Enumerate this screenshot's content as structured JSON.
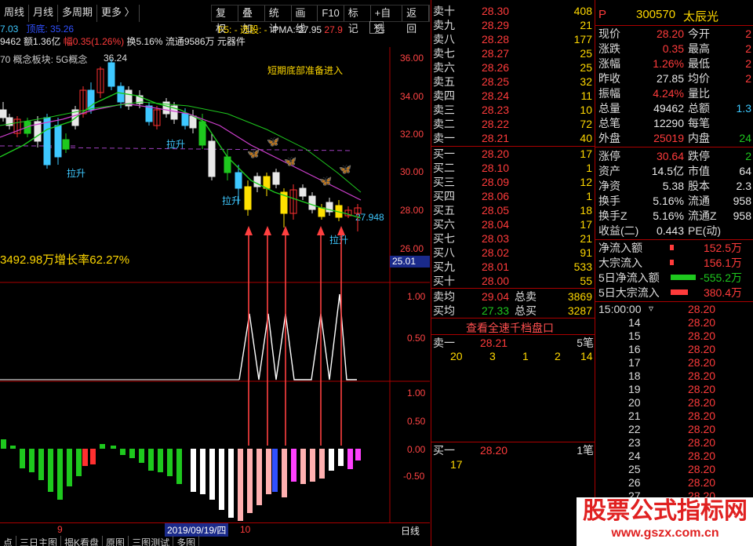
{
  "toolbar": {
    "left": [
      "周线",
      "月线",
      "多周期",
      "更多 〉"
    ],
    "right": [
      "复权",
      "叠加",
      "统计",
      "画线",
      "F10",
      "标记",
      "+自选",
      "返回"
    ]
  },
  "info_row": {
    "a": "7.03",
    "b": "顶底: 35.26",
    "vol": "9462 额1.36亿",
    "amp": "幅0.35(1.26%)",
    "turn": "换5.16% 流通9586万 元器件",
    "f5": "F5:",
    "sel": "- 选股: -",
    "pma": "PMA: 27.95",
    "pma2": "27.9"
  },
  "concept": "70 概念板块: 5G概念",
  "hi_label": "36.24",
  "annot": "短期底部准备进入",
  "lift_labels": [
    "拉升",
    "拉升",
    "拉升",
    "拉升"
  ],
  "last_val": "27.948",
  "growth": "3492.98万增长率62.27%",
  "price_axis": [
    "36.00",
    "34.00",
    "32.00",
    "30.00",
    "28.00",
    "26.00"
  ],
  "cur_price_tag": "25.01",
  "ind1_axis": [
    "1.00",
    "0.50"
  ],
  "ind2_axis": [
    "1.00",
    "0.50",
    "0.00",
    "-0.50"
  ],
  "date_bar": {
    "d1": "9",
    "d2": "2019/09/19/四",
    "d3": "10",
    "period": "日线"
  },
  "bottom_tabs": [
    "点",
    "三日主图",
    "揭K看盘",
    "原图",
    "三图测试",
    "多图"
  ],
  "orderbook": {
    "asks": [
      {
        "label": "卖十",
        "price": "28.30",
        "vol": "408"
      },
      {
        "label": "卖九",
        "price": "28.29",
        "vol": "21"
      },
      {
        "label": "卖八",
        "price": "28.28",
        "vol": "177"
      },
      {
        "label": "卖七",
        "price": "28.27",
        "vol": "25"
      },
      {
        "label": "卖六",
        "price": "28.26",
        "vol": "25"
      },
      {
        "label": "卖五",
        "price": "28.25",
        "vol": "32"
      },
      {
        "label": "卖四",
        "price": "28.24",
        "vol": "11"
      },
      {
        "label": "卖三",
        "price": "28.23",
        "vol": "10"
      },
      {
        "label": "卖二",
        "price": "28.22",
        "vol": "72"
      },
      {
        "label": "卖一",
        "price": "28.21",
        "vol": "40"
      }
    ],
    "bids": [
      {
        "label": "买一",
        "price": "28.20",
        "vol": "17"
      },
      {
        "label": "买二",
        "price": "28.10",
        "vol": "1"
      },
      {
        "label": "买三",
        "price": "28.09",
        "vol": "12"
      },
      {
        "label": "买四",
        "price": "28.06",
        "vol": "1"
      },
      {
        "label": "买五",
        "price": "28.05",
        "vol": "18"
      },
      {
        "label": "买六",
        "price": "28.04",
        "vol": "17"
      },
      {
        "label": "买七",
        "price": "28.03",
        "vol": "21"
      },
      {
        "label": "买八",
        "price": "28.02",
        "vol": "91"
      },
      {
        "label": "买九",
        "price": "28.01",
        "vol": "533"
      },
      {
        "label": "买十",
        "price": "28.00",
        "vol": "55"
      }
    ],
    "avg": {
      "sell_lbl": "卖均",
      "sell": "29.04",
      "tot_sell_lbl": "总卖",
      "tot_sell": "3869",
      "buy_lbl": "买均",
      "buy": "27.33",
      "tot_buy_lbl": "总买",
      "tot_buy": "3287"
    },
    "link": "查看全速千档盘口",
    "sell1": {
      "label": "卖一",
      "price": "28.21",
      "cnt": "5笔",
      "q": [
        "20",
        "3",
        "1",
        "2",
        "14"
      ]
    },
    "buy1": {
      "label": "买一",
      "price": "28.20",
      "cnt": "1笔",
      "q": [
        "17"
      ]
    }
  },
  "stock": {
    "code": "300570",
    "name": "太辰光",
    "p": "P",
    "rows": [
      [
        "现价",
        "28.20",
        "今开",
        "2"
      ],
      [
        "涨跌",
        "0.35",
        "最高",
        "2"
      ],
      [
        "涨幅",
        "1.26%",
        "最低",
        "2"
      ],
      [
        "昨收",
        "27.85",
        "均价",
        "2"
      ],
      [
        "振幅",
        "4.24%",
        "量比",
        ""
      ],
      [
        "总量",
        "49462",
        "总额",
        "1.3"
      ],
      [
        "总笔",
        "12290",
        "每笔",
        ""
      ],
      [
        "外盘",
        "25019",
        "内盘",
        "24"
      ]
    ],
    "rows2": [
      [
        "涨停",
        "30.64",
        "跌停",
        "2"
      ],
      [
        "资产",
        "14.5亿",
        "市值",
        "64"
      ],
      [
        "净资",
        "5.38",
        "股本",
        "2.3"
      ],
      [
        "换手",
        "5.16%",
        "流通",
        "958"
      ],
      [
        "换手Z",
        "5.16%",
        "流通Z",
        "958"
      ],
      [
        "收益(二)",
        "0.443",
        "PE(动)",
        ""
      ]
    ],
    "flows": [
      {
        "label": "净流入额",
        "val": "152.5万"
      },
      {
        "label": "大宗流入",
        "val": "156.1万"
      },
      {
        "label": "5日净流入额",
        "val": "-555.2万"
      },
      {
        "label": "5日大宗流入",
        "val": "380.4万"
      }
    ],
    "ticks_time": "15:00:00",
    "ticks": [
      [
        "14",
        "28.20"
      ],
      [
        "15",
        "28.20"
      ],
      [
        "16",
        "28.20"
      ],
      [
        "17",
        "28.20"
      ],
      [
        "18",
        "28.20"
      ],
      [
        "19",
        "28.20"
      ],
      [
        "20",
        "28.20"
      ],
      [
        "21",
        "28.20"
      ],
      [
        "22",
        "28.20"
      ],
      [
        "23",
        "28.20"
      ],
      [
        "24",
        "28.20"
      ],
      [
        "25",
        "28.20"
      ],
      [
        "26",
        "28.20"
      ],
      [
        "27",
        "28.20"
      ]
    ],
    "first_tick": "28.20"
  },
  "watermark": {
    "line1": "股票公式指标网",
    "line2": "www.gszx.com.cn"
  }
}
